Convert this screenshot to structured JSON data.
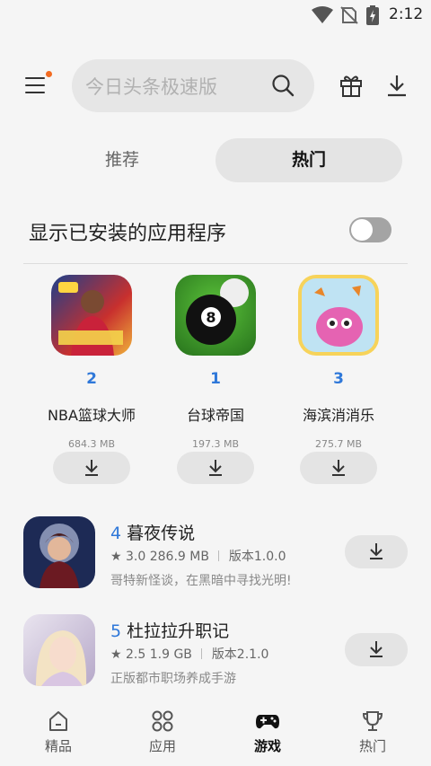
{
  "status_bar": {
    "time": "2:12"
  },
  "search": {
    "placeholder": "今日头条极速版"
  },
  "tabs": [
    {
      "label": "推荐",
      "active": false
    },
    {
      "label": "热门",
      "active": true
    }
  ],
  "installed_toggle": {
    "label": "显示已安装的应用程序",
    "on": false
  },
  "top_apps": [
    {
      "rank": "2",
      "name": "NBA篮球大师",
      "size": "684.3 MB",
      "icon_name": "nba-basketball-master-icon"
    },
    {
      "rank": "1",
      "name": "台球帝国",
      "size": "197.3 MB",
      "icon_name": "billiards-empire-icon"
    },
    {
      "rank": "3",
      "name": "海滨消消乐",
      "size": "275.7 MB",
      "icon_name": "seaside-match-icon"
    }
  ],
  "list_apps": [
    {
      "rank": "4",
      "name": "暮夜传说",
      "rating": "3.0",
      "size": "286.9 MB",
      "version": "版本1.0.0",
      "desc": "哥特新怪谈，在黑暗中寻找光明!"
    },
    {
      "rank": "5",
      "name": "杜拉拉升职记",
      "rating": "2.5",
      "size": "1.9 GB",
      "version": "版本2.1.0",
      "desc": "正版都市职场养成手游"
    }
  ],
  "bottom_nav": [
    {
      "label": "精品",
      "icon": "home-icon",
      "active": false
    },
    {
      "label": "应用",
      "icon": "apps-grid-icon",
      "active": false
    },
    {
      "label": "游戏",
      "icon": "gamepad-icon",
      "active": true
    },
    {
      "label": "热门",
      "icon": "trophy-icon",
      "active": false
    }
  ],
  "colors": {
    "accent_blue": "#2f78d9",
    "notify_dot": "#f26b21",
    "background": "#f5f5f5"
  }
}
